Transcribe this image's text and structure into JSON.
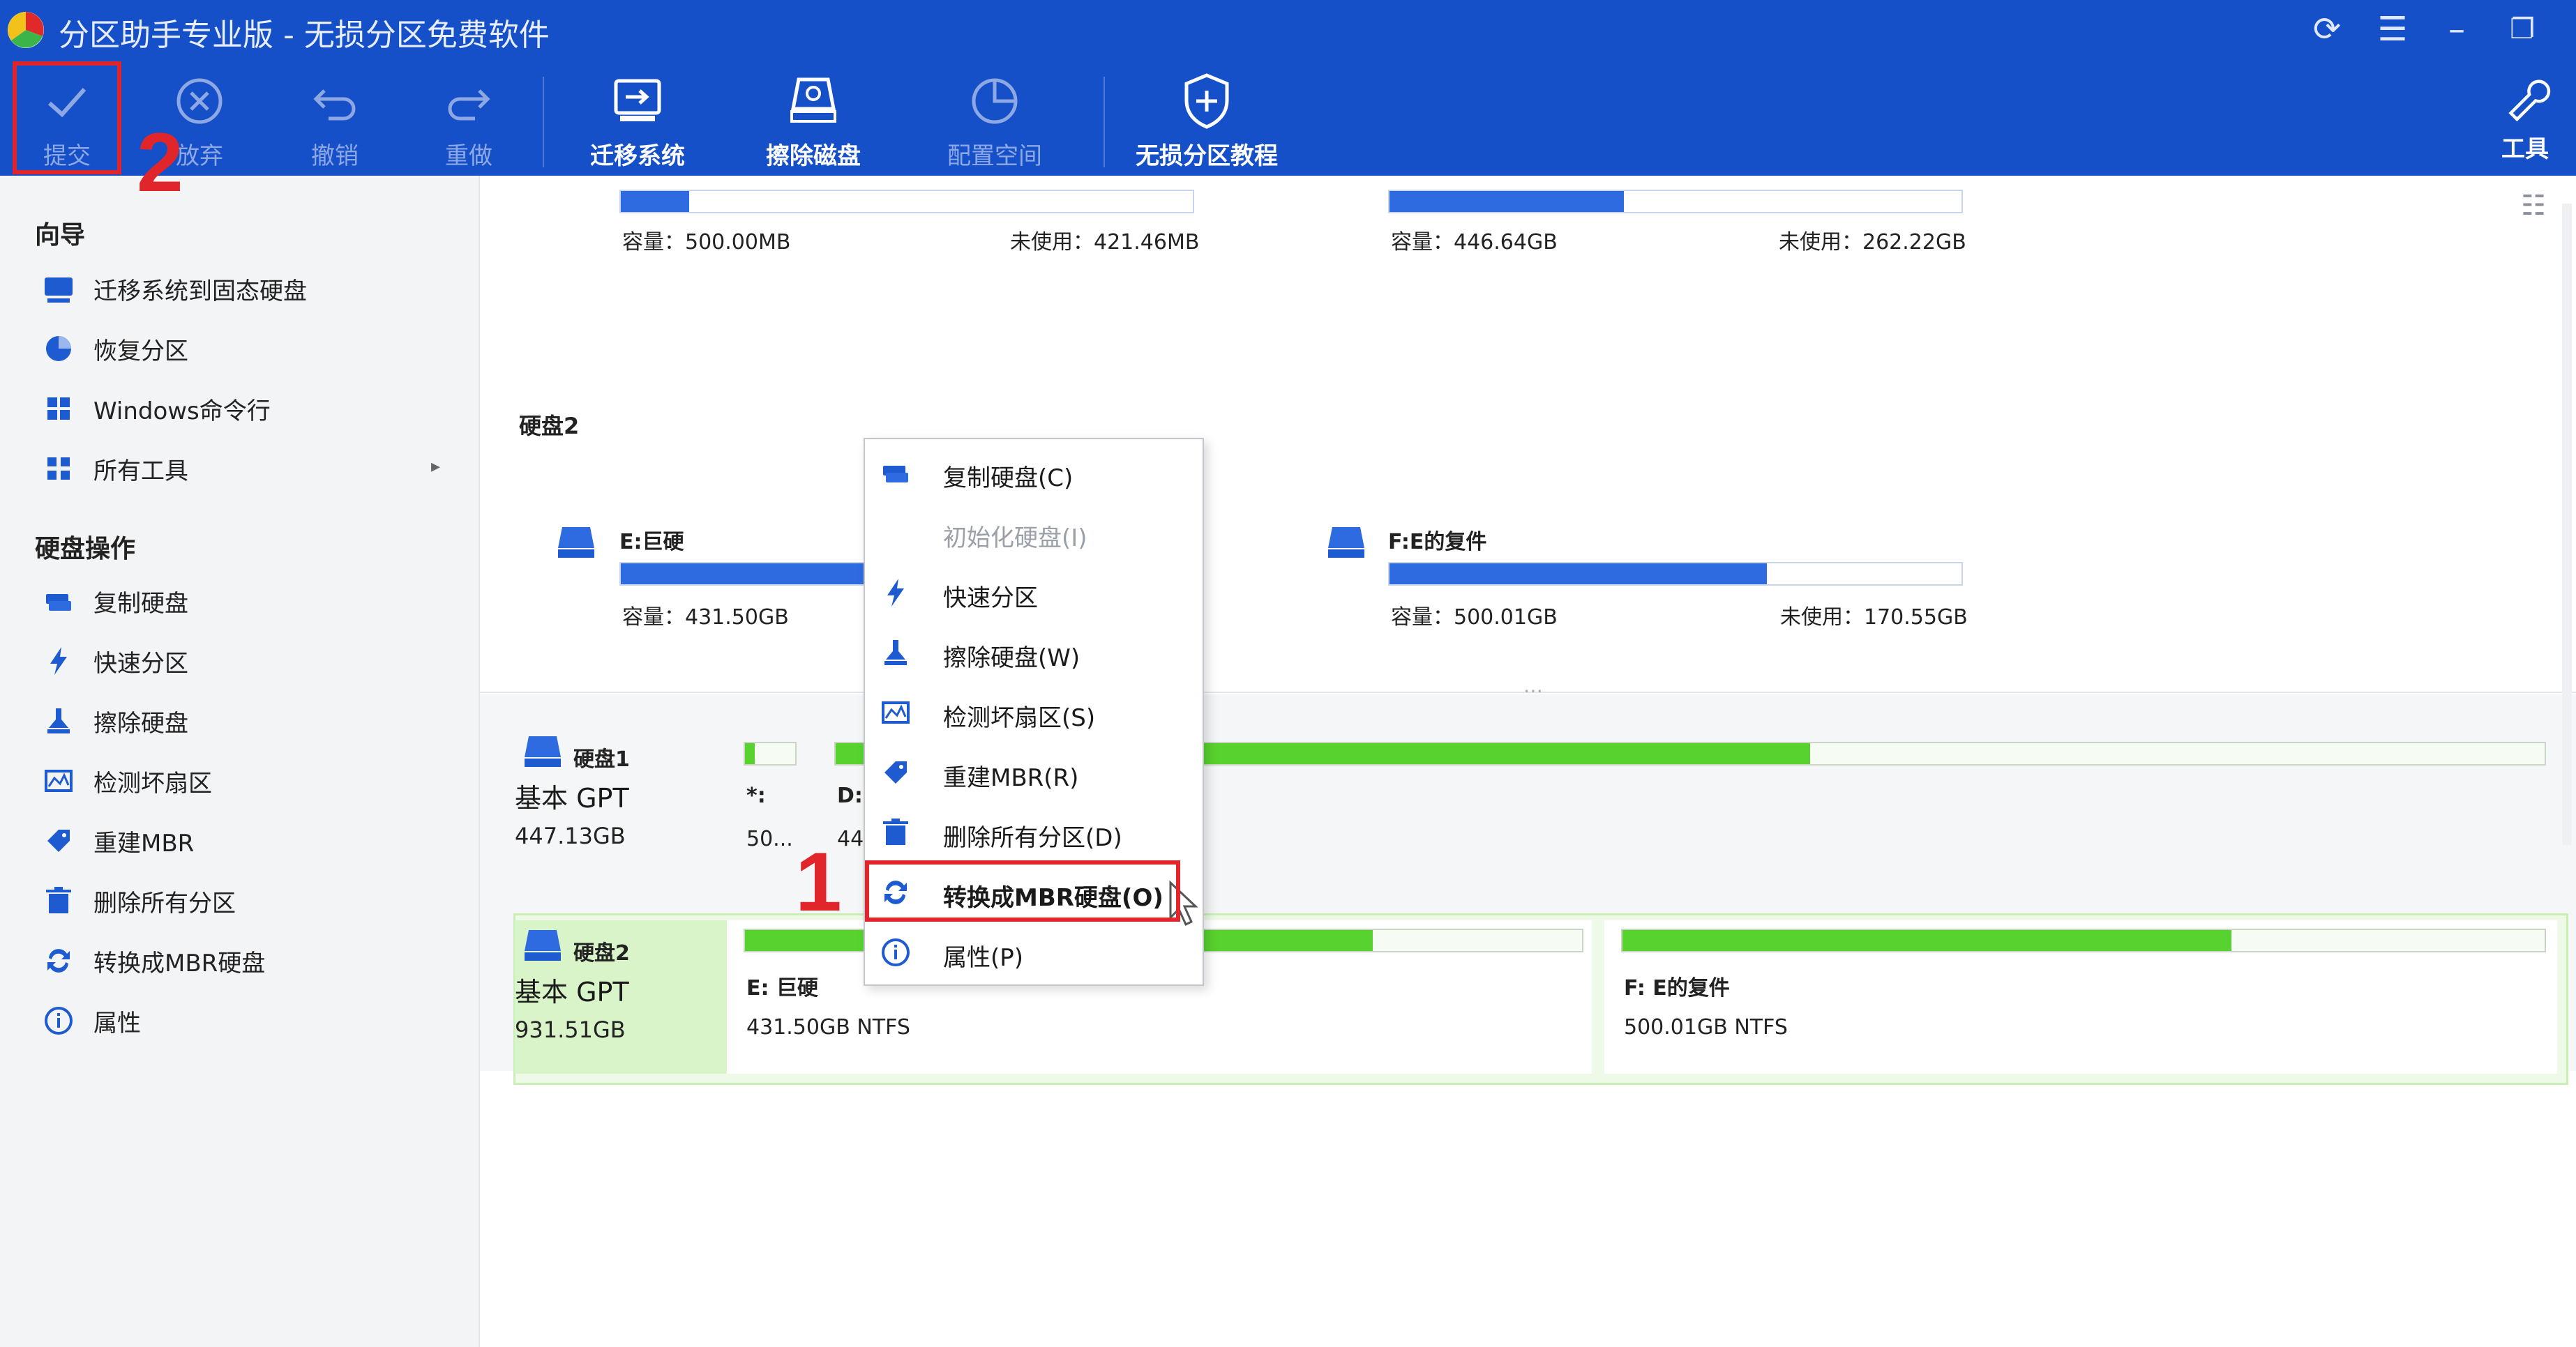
{
  "title": "分区助手专业版 - 无损分区免费软件",
  "toolbar": {
    "items": [
      {
        "label": "提交",
        "icon": "check-icon",
        "enabled": false
      },
      {
        "label": "放弃",
        "icon": "discard-icon",
        "enabled": false
      },
      {
        "label": "撤销",
        "icon": "undo-icon",
        "enabled": false
      },
      {
        "label": "重做",
        "icon": "redo-icon",
        "enabled": false
      },
      {
        "label": "迁移系统",
        "icon": "migrate-os-icon",
        "enabled": true
      },
      {
        "label": "擦除磁盘",
        "icon": "wipe-disk-icon",
        "enabled": true
      },
      {
        "label": "配置空间",
        "icon": "allocate-space-icon",
        "enabled": false
      },
      {
        "label": "无损分区教程",
        "icon": "shield-plus-icon",
        "enabled": true
      }
    ],
    "tools_label": "工具"
  },
  "sidebar": {
    "wizard_header": "向导",
    "wizard_items": [
      {
        "label": "迁移系统到固态硬盘",
        "icon": "migrate-os-icon"
      },
      {
        "label": "恢复分区",
        "icon": "recover-partition-icon"
      },
      {
        "label": "Windows命令行",
        "icon": "windows-icon"
      },
      {
        "label": "所有工具",
        "icon": "all-tools-icon"
      }
    ],
    "disk_ops_header": "硬盘操作",
    "disk_ops_items": [
      {
        "label": "复制硬盘",
        "icon": "copy-disk-icon"
      },
      {
        "label": "快速分区",
        "icon": "lightning-icon"
      },
      {
        "label": "擦除硬盘",
        "icon": "wipe-disk-icon"
      },
      {
        "label": "检测坏扇区",
        "icon": "bad-sector-icon"
      },
      {
        "label": "重建MBR",
        "icon": "rebuild-mbr-icon"
      },
      {
        "label": "删除所有分区",
        "icon": "trash-icon"
      },
      {
        "label": "转换成MBR硬盘",
        "icon": "convert-icon"
      },
      {
        "label": "属性",
        "icon": "info-icon"
      }
    ]
  },
  "upper_view": {
    "disk1_parts": [
      {
        "capacity": "容量：500.00MB",
        "unused": "未使用：421.46MB",
        "used_fraction": 0.12
      },
      {
        "capacity": "容量：446.64GB",
        "unused": "未使用：262.22GB",
        "used_fraction": 0.41
      }
    ],
    "disk2_label": "硬盘2",
    "disk2_parts": [
      {
        "name": "E:巨硬",
        "capacity": "容量：431.50GB",
        "used_fraction": 0.7
      },
      {
        "name": "F:E的复件",
        "capacity": "容量：500.01GB",
        "unused": "未使用：170.55GB",
        "used_fraction": 0.66
      }
    ]
  },
  "lower_view": {
    "disks": [
      {
        "name": "硬盘1",
        "type": "基本 GPT",
        "size": "447.13GB",
        "partitions": [
          {
            "name": "*:",
            "info": "50...",
            "used_fraction": 0.2
          },
          {
            "name": "D:",
            "info": "44",
            "used_fraction": 0.57
          }
        ]
      },
      {
        "name": "硬盘2",
        "type": "基本 GPT",
        "size": "931.51GB",
        "partitions": [
          {
            "name": "E: 巨硬",
            "info": "431.50GB NTFS",
            "used_fraction": 0.75
          },
          {
            "name": "F: E的复件",
            "info": "500.01GB NTFS",
            "used_fraction": 0.66
          }
        ]
      }
    ]
  },
  "context_menu": {
    "items": [
      {
        "label": "复制硬盘(C)",
        "icon": "copy-disk-icon",
        "enabled": true
      },
      {
        "label": "初始化硬盘(I)",
        "icon": "",
        "enabled": false
      },
      {
        "label": "快速分区",
        "icon": "lightning-icon",
        "enabled": true
      },
      {
        "label": "擦除硬盘(W)",
        "icon": "wipe-disk-icon",
        "enabled": true
      },
      {
        "label": "检测坏扇区(S)",
        "icon": "bad-sector-icon",
        "enabled": true
      },
      {
        "label": "重建MBR(R)",
        "icon": "rebuild-mbr-icon",
        "enabled": true
      },
      {
        "label": "删除所有分区(D)",
        "icon": "trash-icon",
        "enabled": true
      },
      {
        "label": "转换成MBR硬盘(O)",
        "icon": "convert-icon",
        "enabled": true,
        "highlighted": true
      },
      {
        "label": "属性(P)",
        "icon": "info-icon",
        "enabled": true
      }
    ]
  },
  "annotations": {
    "step1": "1",
    "step2": "2"
  },
  "colors": {
    "titlebar": "#1550c8",
    "accent_blue": "#2f6be0",
    "partition_green": "#58d22e",
    "annotation_red": "#e0262b"
  }
}
